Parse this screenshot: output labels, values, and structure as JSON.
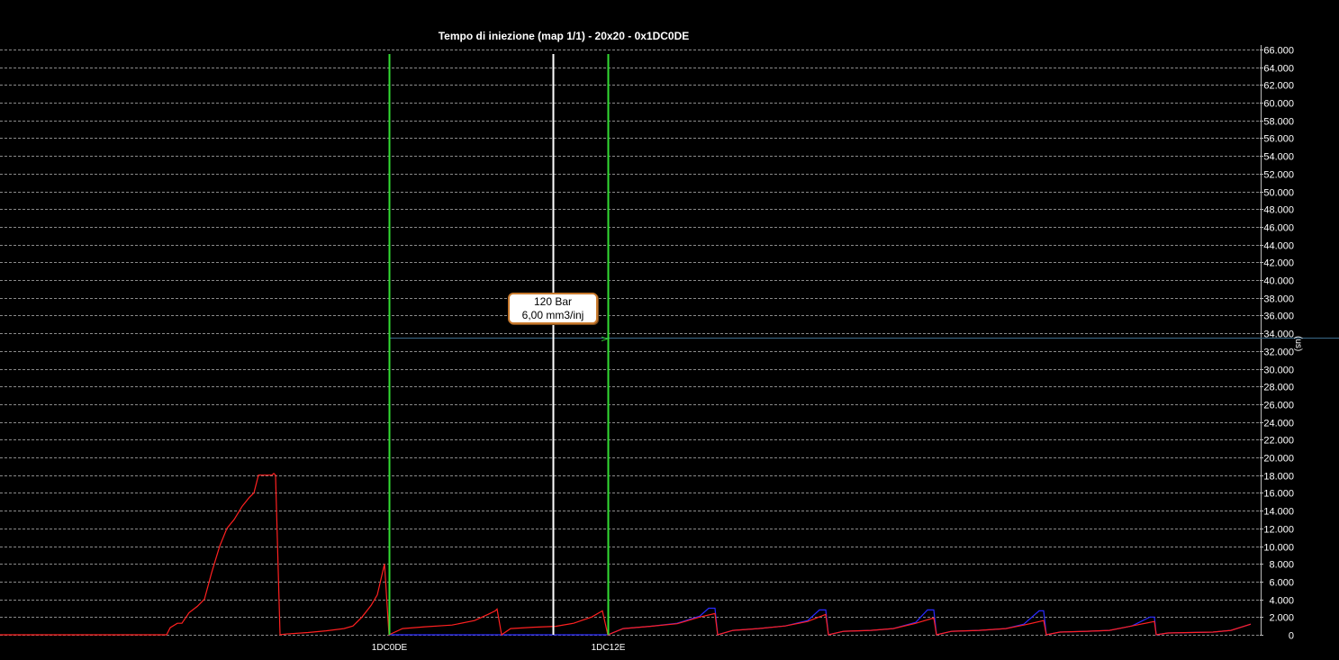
{
  "chart_data": {
    "type": "line",
    "title": "Tempo di iniezione (map 1/1) - 20x20 - 0x1DC0DE",
    "ylabel": "(us)",
    "ylim": [
      0,
      66000
    ],
    "yticks": [
      0,
      2000,
      4000,
      6000,
      8000,
      10000,
      12000,
      14000,
      16000,
      18000,
      20000,
      22000,
      24000,
      26000,
      28000,
      30000,
      32000,
      34000,
      36000,
      38000,
      40000,
      42000,
      44000,
      46000,
      48000,
      50000,
      52000,
      54000,
      56000,
      58000,
      60000,
      62000,
      64000,
      66000
    ],
    "ytick_labels": [
      "0",
      "2.000",
      "4.000",
      "6.000",
      "8.000",
      "10.000",
      "12.000",
      "14.000",
      "16.000",
      "18.000",
      "20.000",
      "22.000",
      "24.000",
      "26.000",
      "28.000",
      "30.000",
      "32.000",
      "34.000",
      "36.000",
      "38.000",
      "40.000",
      "42.000",
      "44.000",
      "46.000",
      "48.000",
      "50.000",
      "52.000",
      "54.000",
      "56.000",
      "58.000",
      "60.000",
      "62.000",
      "64.000",
      "66.000"
    ],
    "grid": true,
    "xlim": [
      -432,
      968
    ],
    "x_markers": [
      {
        "x": 0,
        "label": "1DC0DE",
        "color": "#33dd33"
      },
      {
        "x": 243,
        "label": "1DC12E",
        "color": "#33dd33"
      },
      {
        "x": 182,
        "label": "",
        "color": "#ffffff"
      }
    ],
    "cursor_value": 33500,
    "tooltip": [
      "120 Bar",
      "6,00 mm3/inj"
    ],
    "series": [
      {
        "color": "#ff2020",
        "points": [
          [
            -432,
            0
          ],
          [
            -247,
            0
          ],
          [
            -243,
            800
          ],
          [
            -235,
            1300
          ],
          [
            -230,
            1300
          ],
          [
            -222,
            2500
          ],
          [
            -213,
            3200
          ],
          [
            -205,
            4000
          ],
          [
            -197,
            7000
          ],
          [
            -188,
            10000
          ],
          [
            -180,
            12000
          ],
          [
            -172,
            13000
          ],
          [
            -163,
            14500
          ],
          [
            -155,
            15500
          ],
          [
            -150,
            16000
          ],
          [
            -145,
            18000
          ],
          [
            -130,
            18000
          ],
          [
            -128,
            18200
          ],
          [
            -126,
            18000
          ],
          [
            -121,
            0
          ],
          [
            -115,
            80
          ],
          [
            -90,
            250
          ],
          [
            -70,
            450
          ],
          [
            -50,
            700
          ],
          [
            -40,
            1000
          ],
          [
            -30,
            2000
          ],
          [
            -20,
            3300
          ],
          [
            -13,
            4500
          ],
          [
            -5,
            8000
          ],
          [
            0,
            0
          ],
          [
            15,
            700
          ],
          [
            40,
            900
          ],
          [
            70,
            1100
          ],
          [
            95,
            1600
          ],
          [
            110,
            2300
          ],
          [
            118,
            2700
          ],
          [
            120,
            2900
          ],
          [
            125,
            0
          ],
          [
            135,
            700
          ],
          [
            160,
            850
          ],
          [
            185,
            950
          ],
          [
            205,
            1300
          ],
          [
            225,
            2000
          ],
          [
            237,
            2700
          ],
          [
            243,
            0
          ],
          [
            260,
            700
          ],
          [
            290,
            950
          ],
          [
            320,
            1250
          ],
          [
            345,
            2000
          ],
          [
            362,
            2400
          ],
          [
            365,
            0
          ],
          [
            382,
            500
          ],
          [
            410,
            700
          ],
          [
            440,
            1000
          ],
          [
            465,
            1500
          ],
          [
            485,
            2300
          ],
          [
            488,
            0
          ],
          [
            505,
            400
          ],
          [
            535,
            500
          ],
          [
            560,
            700
          ],
          [
            585,
            1300
          ],
          [
            605,
            1900
          ],
          [
            608,
            0
          ],
          [
            625,
            400
          ],
          [
            655,
            500
          ],
          [
            685,
            700
          ],
          [
            705,
            1100
          ],
          [
            727,
            1600
          ],
          [
            730,
            0
          ],
          [
            745,
            300
          ],
          [
            775,
            400
          ],
          [
            800,
            500
          ],
          [
            825,
            1000
          ],
          [
            850,
            1500
          ],
          [
            852,
            0
          ],
          [
            865,
            200
          ],
          [
            890,
            250
          ],
          [
            915,
            300
          ],
          [
            935,
            500
          ],
          [
            957,
            1200
          ]
        ]
      },
      {
        "color": "#2a2aff",
        "points": [
          [
            0,
            0
          ],
          [
            243,
            0
          ],
          [
            260,
            700
          ],
          [
            290,
            950
          ],
          [
            320,
            1300
          ],
          [
            345,
            2100
          ],
          [
            355,
            3000
          ],
          [
            362,
            3000
          ],
          [
            365,
            0
          ],
          [
            382,
            500
          ],
          [
            410,
            700
          ],
          [
            440,
            1000
          ],
          [
            465,
            1600
          ],
          [
            478,
            2800
          ],
          [
            485,
            2800
          ],
          [
            488,
            0
          ],
          [
            505,
            400
          ],
          [
            535,
            500
          ],
          [
            560,
            700
          ],
          [
            585,
            1400
          ],
          [
            598,
            2800
          ],
          [
            605,
            2800
          ],
          [
            608,
            0
          ],
          [
            625,
            400
          ],
          [
            655,
            500
          ],
          [
            685,
            700
          ],
          [
            705,
            1200
          ],
          [
            722,
            2700
          ],
          [
            727,
            2700
          ],
          [
            730,
            0
          ],
          [
            745,
            300
          ],
          [
            775,
            400
          ],
          [
            800,
            500
          ],
          [
            825,
            1000
          ],
          [
            845,
            2000
          ],
          [
            850,
            2000
          ],
          [
            852,
            0
          ],
          [
            865,
            200
          ],
          [
            890,
            250
          ],
          [
            915,
            300
          ],
          [
            935,
            500
          ],
          [
            957,
            1200
          ]
        ]
      }
    ]
  }
}
